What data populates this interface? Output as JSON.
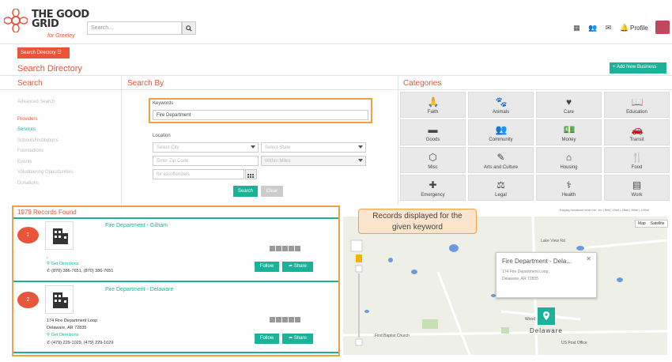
{
  "header": {
    "logo_line1": "THE GOOD",
    "logo_line2": "GRID",
    "logo_tag": "for Greeley",
    "search_placeholder": "Search...",
    "profile_label": "Profile",
    "icons": [
      "grid-icon",
      "users-icon",
      "mail-icon",
      "bell-icon"
    ]
  },
  "toolbar": {
    "search_directory_label": "Search Directory",
    "page_title": "Search Directory",
    "add_business_label": "+ Add New Business"
  },
  "sections": {
    "search": "Search",
    "search_by": "Search By",
    "categories": "Categories"
  },
  "sidebar": {
    "items": [
      {
        "label": "Advanced Search"
      },
      {
        "label": "Providers"
      },
      {
        "label": "Services"
      },
      {
        "label": "Schools/Institutions"
      },
      {
        "label": "Foundations"
      },
      {
        "label": "Events"
      },
      {
        "label": "Volunteering Opportunities"
      },
      {
        "label": "Donations"
      }
    ]
  },
  "form": {
    "keywords_label": "Keywords",
    "keywords_value": "Fire Department",
    "location_label": "Location",
    "city_placeholder": "Select City",
    "state_placeholder": "Select State",
    "zip_placeholder": "Enter Zip Code",
    "miles_placeholder": "Within Miles",
    "offender_placeholder": "for ex-offenders",
    "search_button": "Search",
    "clear_button": "Clear"
  },
  "categories": [
    {
      "label": "Faith",
      "icon": "praying-hands-icon"
    },
    {
      "label": "Animals",
      "icon": "paw-icon"
    },
    {
      "label": "Care",
      "icon": "heart-icon"
    },
    {
      "label": "Education",
      "icon": "book-icon"
    },
    {
      "label": "Goods",
      "icon": "goods-icon"
    },
    {
      "label": "Community",
      "icon": "community-icon"
    },
    {
      "label": "Money",
      "icon": "money-icon"
    },
    {
      "label": "Transit",
      "icon": "car-icon"
    },
    {
      "label": "Misc",
      "icon": "cube-icon"
    },
    {
      "label": "Arts and Culture",
      "icon": "brush-icon"
    },
    {
      "label": "Housing",
      "icon": "house-icon"
    },
    {
      "label": "Food",
      "icon": "fork-knife-icon"
    },
    {
      "label": "Emergency",
      "icon": "first-aid-icon"
    },
    {
      "label": "Legal",
      "icon": "gavel-icon"
    },
    {
      "label": "Health",
      "icon": "stethoscope-icon"
    },
    {
      "label": "Work",
      "icon": "building-icon"
    }
  ],
  "results": {
    "count_label": "1979 Records Found",
    "items": [
      {
        "number": "1",
        "title": "Fire Department - Gilham",
        "address_line1": ",",
        "address_line2": "",
        "directions": "Get Directions",
        "phone": "(870) 386-7651, (870) 386-7651",
        "follow": "Follow",
        "share": "Share"
      },
      {
        "number": "2",
        "title": "Fire Department - Delaware",
        "address_line1": "174 Fire Department Loop",
        "address_line2": "Delaware, AR 72835",
        "directions": "Get Directions",
        "phone": "(479) 229-1029, (479) 229-1029",
        "follow": "Follow",
        "share": "Share"
      }
    ]
  },
  "map": {
    "locations_note": "Display locations near me: 1m | 5mi | 10mi | 25mi | 50mi | 100mi",
    "type_map": "Map",
    "type_satellite": "Satellite",
    "popup_title": "Fire Department - Dela...",
    "popup_line1": "174 Fire Department Loop,",
    "popup_line2": "Delaware, AR 72835",
    "labels": {
      "lake_view": "Lake View Rd",
      "delaware": "Delaware",
      "church": "First Baptist Church",
      "post_office": "US Post Office",
      "wood": "Wood"
    }
  },
  "callout": {
    "line1": "Records displayed for the",
    "line2": "given keyword"
  },
  "colors": {
    "accent": "#e8553b",
    "teal": "#1bb29a",
    "highlight": "#f0a045"
  }
}
